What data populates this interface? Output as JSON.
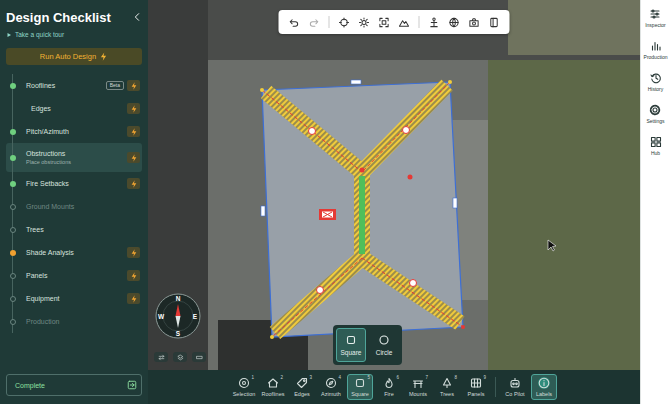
{
  "sidebar": {
    "title": "Design Checklist",
    "tour": "Take a quick tour",
    "auto_design": "Run Auto Design",
    "steps": [
      {
        "label": "Rooflines",
        "kind": "step",
        "status": "done",
        "badge": "Beta",
        "auto": true,
        "selected": false,
        "disabled": false
      },
      {
        "label": "Edges",
        "kind": "substep",
        "auto": true,
        "selected": false,
        "disabled": false
      },
      {
        "label": "Pitch/Azimuth",
        "kind": "step",
        "status": "done",
        "auto": true,
        "selected": false,
        "disabled": false
      },
      {
        "label": "Obstructions",
        "kind": "step",
        "status": "done",
        "subtitle": "Place obstructions",
        "auto": true,
        "selected": true,
        "disabled": false
      },
      {
        "label": "Fire Setbacks",
        "kind": "step",
        "status": "done",
        "auto": true,
        "selected": false,
        "disabled": false
      },
      {
        "label": "Ground Mounts",
        "kind": "step",
        "status": "pending",
        "auto": false,
        "selected": false,
        "disabled": true
      },
      {
        "label": "Trees",
        "kind": "step",
        "status": "pending",
        "auto": false,
        "selected": false,
        "disabled": false
      },
      {
        "label": "Shade Analysis",
        "kind": "step",
        "status": "warning",
        "auto": true,
        "selected": false,
        "disabled": false
      },
      {
        "label": "Panels",
        "kind": "step",
        "status": "pending",
        "auto": true,
        "selected": false,
        "disabled": false
      },
      {
        "label": "Equipment",
        "kind": "step",
        "status": "pending",
        "auto": true,
        "selected": false,
        "disabled": false
      },
      {
        "label": "Production",
        "kind": "step",
        "status": "pending",
        "auto": false,
        "selected": false,
        "disabled": true
      }
    ],
    "complete": "Complete"
  },
  "compass": [
    "N",
    "E",
    "S",
    "W"
  ],
  "shape_picker": [
    {
      "label": "Square",
      "selected": true
    },
    {
      "label": "Circle",
      "selected": false
    }
  ],
  "tools": [
    {
      "label": "Selection",
      "key": "1",
      "selected": false
    },
    {
      "label": "Rooflines",
      "key": "2",
      "selected": false
    },
    {
      "label": "Edges",
      "key": "3",
      "selected": false
    },
    {
      "label": "Azimuth",
      "key": "4",
      "selected": false
    },
    {
      "label": "Square",
      "key": "5",
      "selected": true
    },
    {
      "label": "Fire",
      "key": "6",
      "selected": false
    },
    {
      "label": "Mounts",
      "key": "7",
      "selected": false
    },
    {
      "label": "Trees",
      "key": "8",
      "selected": false
    },
    {
      "label": "Panels",
      "key": "9",
      "selected": false
    },
    {
      "label": "Co Pilot",
      "selected": false
    },
    {
      "label": "Labels",
      "selected": true
    }
  ],
  "rail": [
    {
      "label": "Inspector"
    },
    {
      "label": "Production"
    },
    {
      "label": "History"
    },
    {
      "label": "Settings"
    },
    {
      "label": "Hub"
    }
  ]
}
